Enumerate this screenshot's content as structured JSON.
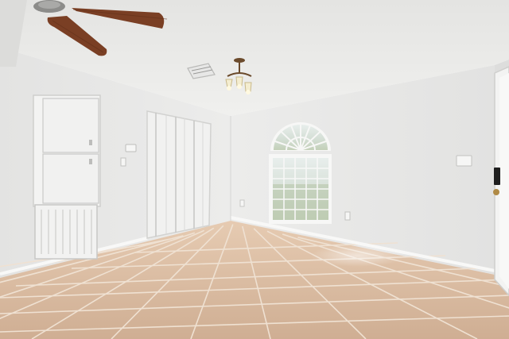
{
  "scene": {
    "kind": "photo",
    "subject": "empty-room",
    "colors": {
      "ceiling": "#ececea",
      "wall_left": "#e9e9e8",
      "wall_back": "#e6e6e5",
      "floor": "#d9bba1",
      "grout": "#efe1d2",
      "trim": "#f7f7f6",
      "fan_blade": "#7a3f24",
      "window_light": "#dfe7e5",
      "greenery": "#b9c9a6"
    },
    "icons": [
      "ceiling-fan-icon",
      "light-fixture-icon",
      "air-vent-icon",
      "thermostat-icon",
      "light-switch-icon",
      "outlet-icon",
      "door-lock-icon"
    ]
  }
}
